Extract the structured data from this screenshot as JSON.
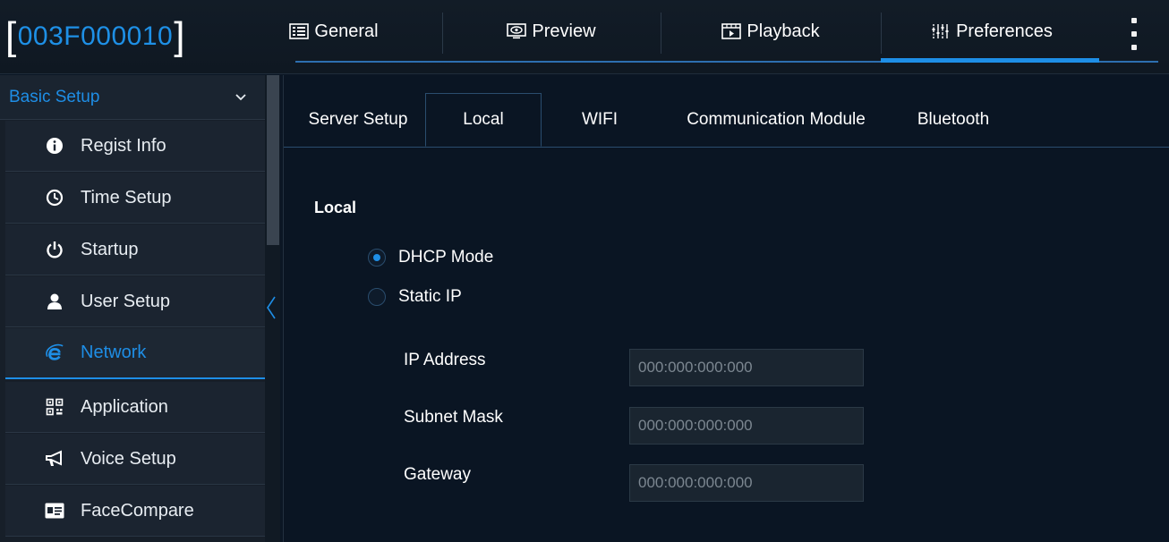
{
  "header": {
    "device_id": "003F000010",
    "tabs": [
      {
        "label": "General",
        "icon": "general-icon"
      },
      {
        "label": "Preview",
        "icon": "preview-icon"
      },
      {
        "label": "Playback",
        "icon": "playback-icon"
      },
      {
        "label": "Preferences",
        "icon": "preferences-icon"
      }
    ],
    "active_tab": "Preferences",
    "menu_icon": "kebab-menu-icon"
  },
  "sidebar": {
    "section_title": "Basic Setup",
    "items": [
      {
        "label": "Regist Info",
        "icon": "info-icon"
      },
      {
        "label": "Time Setup",
        "icon": "clock-icon"
      },
      {
        "label": "Startup",
        "icon": "power-icon"
      },
      {
        "label": "User Setup",
        "icon": "user-icon"
      },
      {
        "label": "Network",
        "icon": "network-icon"
      },
      {
        "label": "Application",
        "icon": "qr-code-icon"
      },
      {
        "label": "Voice Setup",
        "icon": "megaphone-icon"
      },
      {
        "label": "FaceCompare",
        "icon": "id-card-icon"
      }
    ],
    "active_item": "Network"
  },
  "main": {
    "tabs": [
      {
        "label": "Server Setup"
      },
      {
        "label": "Local"
      },
      {
        "label": "WIFI"
      },
      {
        "label": "Communication Module"
      },
      {
        "label": "Bluetooth"
      }
    ],
    "active_tab": "Local",
    "section_title": "Local",
    "modes": [
      {
        "label": "DHCP Mode",
        "selected": true
      },
      {
        "label": "Static IP",
        "selected": false
      }
    ],
    "fields": [
      {
        "label": "IP Address",
        "placeholder": "000:000:000:000"
      },
      {
        "label": "Subnet Mask",
        "placeholder": "000:000:000:000"
      },
      {
        "label": "Gateway",
        "placeholder": "000:000:000:000"
      }
    ]
  },
  "colors": {
    "accent": "#1e8ee6",
    "background": "#0a1523",
    "sidebar": "#1b2430"
  }
}
